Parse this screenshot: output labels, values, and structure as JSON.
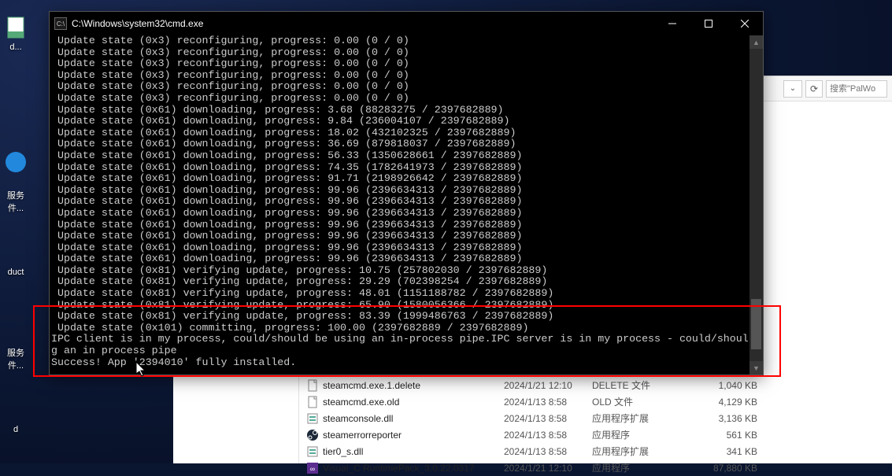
{
  "cmd": {
    "title": "C:\\Windows\\system32\\cmd.exe",
    "icon_glyph": "C:\\",
    "lines": [
      " Update state (0x3) reconfiguring, progress: 0.00 (0 / 0)",
      " Update state (0x3) reconfiguring, progress: 0.00 (0 / 0)",
      " Update state (0x3) reconfiguring, progress: 0.00 (0 / 0)",
      " Update state (0x3) reconfiguring, progress: 0.00 (0 / 0)",
      " Update state (0x3) reconfiguring, progress: 0.00 (0 / 0)",
      " Update state (0x3) reconfiguring, progress: 0.00 (0 / 0)",
      " Update state (0x61) downloading, progress: 3.68 (88283275 / 2397682889)",
      " Update state (0x61) downloading, progress: 9.84 (236004107 / 2397682889)",
      " Update state (0x61) downloading, progress: 18.02 (432102325 / 2397682889)",
      " Update state (0x61) downloading, progress: 36.69 (879818037 / 2397682889)",
      " Update state (0x61) downloading, progress: 56.33 (1350628661 / 2397682889)",
      " Update state (0x61) downloading, progress: 74.35 (1782641973 / 2397682889)",
      " Update state (0x61) downloading, progress: 91.71 (2198926642 / 2397682889)",
      " Update state (0x61) downloading, progress: 99.96 (2396634313 / 2397682889)",
      " Update state (0x61) downloading, progress: 99.96 (2396634313 / 2397682889)",
      " Update state (0x61) downloading, progress: 99.96 (2396634313 / 2397682889)",
      " Update state (0x61) downloading, progress: 99.96 (2396634313 / 2397682889)",
      " Update state (0x61) downloading, progress: 99.96 (2396634313 / 2397682889)",
      " Update state (0x61) downloading, progress: 99.96 (2396634313 / 2397682889)",
      " Update state (0x61) downloading, progress: 99.96 (2396634313 / 2397682889)",
      " Update state (0x81) verifying update, progress: 10.75 (257802030 / 2397682889)",
      " Update state (0x81) verifying update, progress: 29.29 (702398254 / 2397682889)",
      " Update state (0x81) verifying update, progress: 48.01 (1151188782 / 2397682889)",
      " Update state (0x81) verifying update, progress: 65.90 (1580056366 / 2397682889)",
      " Update state (0x81) verifying update, progress: 83.39 (1999486763 / 2397682889)",
      " Update state (0x101) committing, progress: 100.00 (2397682889 / 2397682889)",
      "IPC client is in my process, could/should be using an in-process pipe.IPC server is in my process - could/should be usin",
      "g an in process pipe",
      "Success! App '2394010' fully installed."
    ],
    "cursor": "_"
  },
  "explorer": {
    "search_dropdown": "✓",
    "search_placeholder": "搜索\"PalWo",
    "files": [
      {
        "icon": "file",
        "name": "steamcmd.exe.1.delete",
        "date": "2024/1/21 12:10",
        "type": "DELETE 文件",
        "size": "1,040 KB"
      },
      {
        "icon": "file",
        "name": "steamcmd.exe.old",
        "date": "2024/1/13 8:58",
        "type": "OLD 文件",
        "size": "4,129 KB"
      },
      {
        "icon": "dll",
        "name": "steamconsole.dll",
        "date": "2024/1/13 8:58",
        "type": "应用程序扩展",
        "size": "3,136 KB"
      },
      {
        "icon": "steam",
        "name": "steamerrorreporter",
        "date": "2024/1/13 8:58",
        "type": "应用程序",
        "size": "561 KB"
      },
      {
        "icon": "dll",
        "name": "tier0_s.dll",
        "date": "2024/1/13 8:58",
        "type": "应用程序扩展",
        "size": "341 KB"
      },
      {
        "icon": "visualc",
        "name": "Visual_C  RuntimePack_3.0.22.0317",
        "date": "2024/1/21 12:10",
        "type": "应用程序",
        "size": "87,880 KB"
      }
    ]
  },
  "desktop_icons": {
    "d1": "d...",
    "d2": "",
    "d3": "服务\n件...",
    "d4": "duct",
    "d5": "服务\n件...",
    "d6": "d"
  }
}
